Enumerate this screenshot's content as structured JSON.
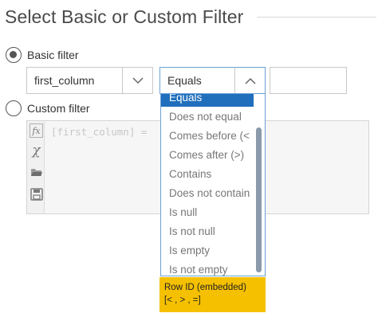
{
  "title": "Select Basic or Custom Filter",
  "basic_filter": {
    "label": "Basic filter",
    "selected": true,
    "column": {
      "value": "first_column"
    },
    "operator": {
      "value": "Equals"
    },
    "value": ""
  },
  "custom_filter": {
    "label": "Custom filter",
    "selected": false,
    "expression": "[first_column] ="
  },
  "operator_options": [
    "Equals",
    "Does not equal",
    "Comes before (<",
    "Comes after (>)",
    "Contains",
    "Does not contain",
    "Is null",
    "Is not null",
    "Is empty",
    "Is not empty"
  ],
  "tooltip": {
    "line1": "Row ID (embedded)",
    "line2": "[< , > , =]"
  },
  "colors": {
    "accent": "#1f6fbd",
    "focus_border": "#6ca0d6",
    "tooltip_bg": "#f5c000"
  }
}
